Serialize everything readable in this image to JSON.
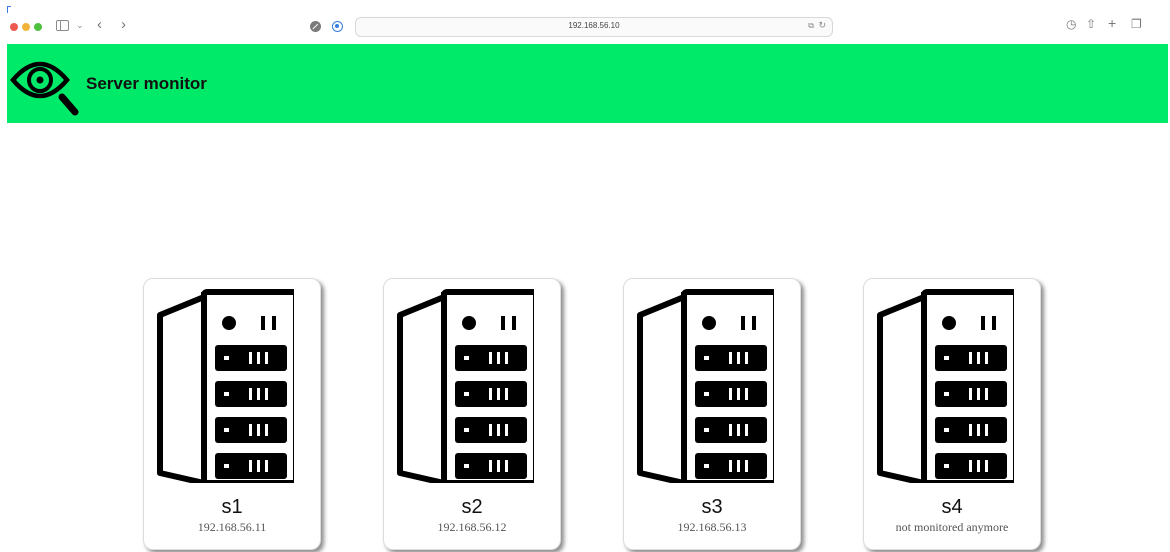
{
  "browser": {
    "url": "192.168.56.10"
  },
  "header": {
    "title": "Server monitor",
    "background_color": "#00ea6a",
    "logo_icon": "eye-magnifier-icon"
  },
  "servers": [
    {
      "name": "s1",
      "subtitle": "192.168.56.11"
    },
    {
      "name": "s2",
      "subtitle": "192.168.56.12"
    },
    {
      "name": "s3",
      "subtitle": "192.168.56.13"
    },
    {
      "name": "s4",
      "subtitle": "not monitored anymore"
    }
  ]
}
